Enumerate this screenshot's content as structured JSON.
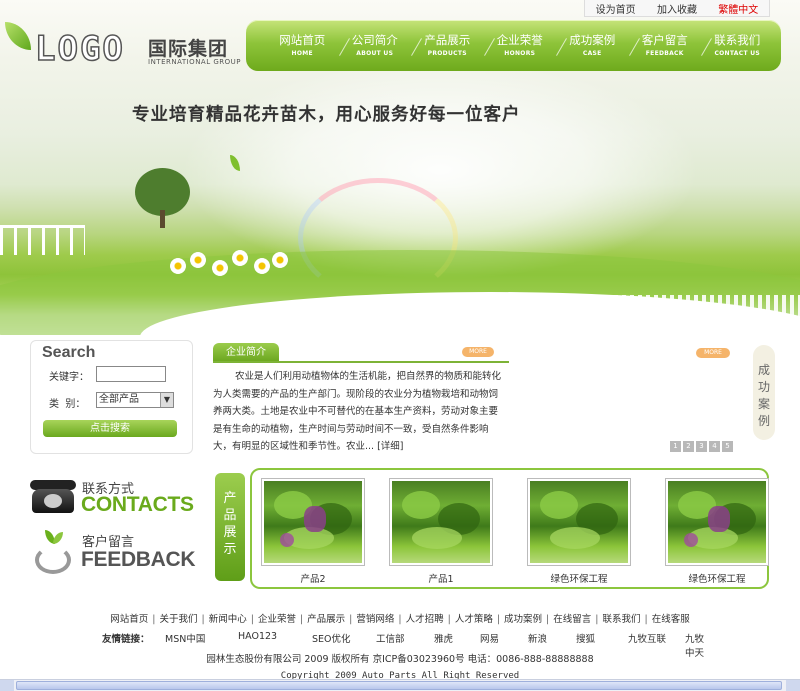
{
  "top_links": {
    "set_home": "设为首页",
    "add_fav": "加入收藏",
    "trad_cn": "繁體中文"
  },
  "logo": {
    "text": "LOGO",
    "cn": "国际集团",
    "en": "INTERNATIONAL GROUP"
  },
  "nav": [
    {
      "cn": "网站首页",
      "en": "HOME"
    },
    {
      "cn": "公司简介",
      "en": "ABOUT US"
    },
    {
      "cn": "产品展示",
      "en": "PRODUCTS"
    },
    {
      "cn": "企业荣誉",
      "en": "HONORS"
    },
    {
      "cn": "成功案例",
      "en": "CASE"
    },
    {
      "cn": "客户留言",
      "en": "FEEDBACK"
    },
    {
      "cn": "联系我们",
      "en": "CONTACT US"
    }
  ],
  "slogan": "专业培育精品花卉苗木，用心服务好每一位客户",
  "search": {
    "title": "Search",
    "keyword_label": "关键字：",
    "keyword_value": "",
    "category_label": "类  别：",
    "category_value": "全部产品",
    "button": "点击搜索"
  },
  "about": {
    "tab": "企业简介",
    "more": "MORE",
    "text": "农业是人们利用动植物体的生活机能，把自然界的物质和能转化为人类需要的产品的生产部门。现阶段的农业分为植物栽培和动物饲养两大类。土地是农业中不可替代的在基本生产资料，劳动对象主要是有生命的动植物，生产时间与劳动时间不一致，受自然条件影响大，有明显的区域性和季节性。农业...",
    "detail": "[详细]"
  },
  "cases": {
    "title": "成功案例",
    "more": "MORE",
    "pages": [
      "1",
      "2",
      "3",
      "4",
      "5"
    ]
  },
  "contacts": {
    "cn": "联系方式",
    "en": "CONTACTS"
  },
  "feedback": {
    "cn": "客户留言",
    "en": "FEEDBACK"
  },
  "products": {
    "label": "产品展示",
    "items": [
      {
        "name": "产品2",
        "flowers": true
      },
      {
        "name": "产品1",
        "flowers": false
      },
      {
        "name": "绿色环保工程",
        "flowers": false
      },
      {
        "name": "绿色环保工程",
        "flowers": true
      }
    ]
  },
  "footer": {
    "nav": [
      "网站首页",
      "关于我们",
      "新闻中心",
      "企业荣誉",
      "产品展示",
      "营销网络",
      "人才招聘",
      "人才策略",
      "成功案例",
      "在线留言",
      "联系我们",
      "在线客服"
    ],
    "friend_label": "友情链接：",
    "friends": [
      "MSN中国",
      "HAO123",
      "SEO优化",
      "工信部",
      "雅虎",
      "网易",
      "新浪",
      "搜狐",
      "九牧互联",
      "九牧中天"
    ],
    "copyright": "园林生态股份有限公司 2009 版权所有 京ICP备03023960号 电话：0086-888-88888888",
    "copyright_en": "Copyright 2009 Auto Parts All Right Reserved"
  }
}
